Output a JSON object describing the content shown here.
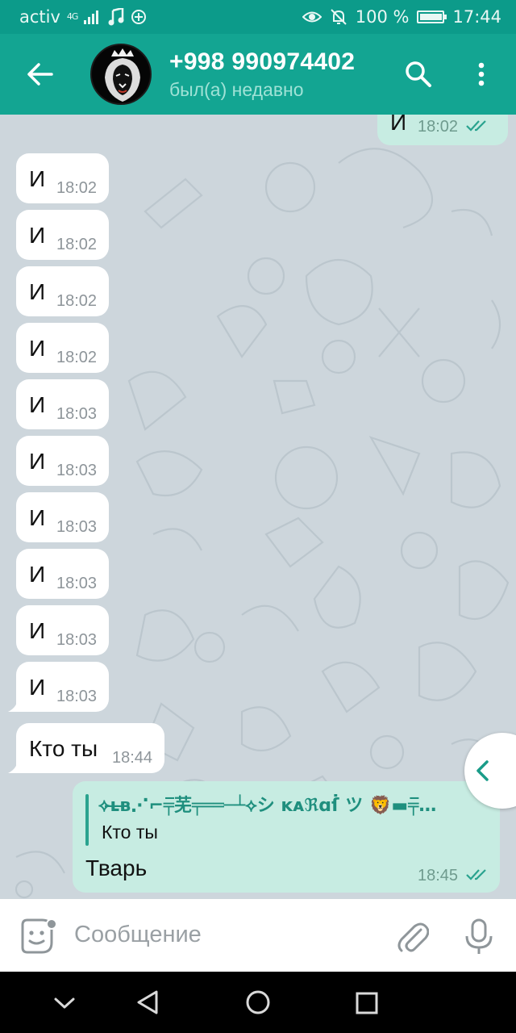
{
  "status_bar": {
    "carrier": "activ",
    "network": "4G",
    "battery": "100 %",
    "time": "17:44",
    "icons": [
      "signal-icon",
      "music-icon",
      "sync-icon",
      "eye-icon",
      "mute-icon",
      "battery-icon"
    ]
  },
  "header": {
    "title": "+998 990974402",
    "subtitle": "был(а) недавно"
  },
  "messages": [
    {
      "dir": "out",
      "text": "И",
      "time": "18:02",
      "status": "read"
    },
    {
      "dir": "in",
      "text": "И",
      "time": "18:02"
    },
    {
      "dir": "in",
      "text": "И",
      "time": "18:02"
    },
    {
      "dir": "in",
      "text": "И",
      "time": "18:02"
    },
    {
      "dir": "in",
      "text": "И",
      "time": "18:02"
    },
    {
      "dir": "in",
      "text": "И",
      "time": "18:03"
    },
    {
      "dir": "in",
      "text": "И",
      "time": "18:03"
    },
    {
      "dir": "in",
      "text": "И",
      "time": "18:03"
    },
    {
      "dir": "in",
      "text": "И",
      "time": "18:03"
    },
    {
      "dir": "in",
      "text": "И",
      "time": "18:03"
    },
    {
      "dir": "in",
      "text": "И",
      "time": "18:03"
    },
    {
      "dir": "in",
      "text": "Кто ты",
      "time": "18:44"
    },
    {
      "dir": "out",
      "reply_author": "⟡ʟ̶ʙ̶⋰⌐╤̅芜╤══─┴⟡シ ĸᴀℜɑẛ ツ 🦁▬╤̅…",
      "reply_text": "Кто ты",
      "text": "Тварь",
      "time": "18:45",
      "status": "read"
    }
  ],
  "input": {
    "placeholder": "Сообщение"
  },
  "colors": {
    "status_bar": "#0c9b8a",
    "header": "#13a592",
    "outgoing_bubble": "#c7ece2",
    "incoming_bubble": "#ffffff",
    "accent": "#13a592",
    "read_check": "#2aa38f"
  }
}
